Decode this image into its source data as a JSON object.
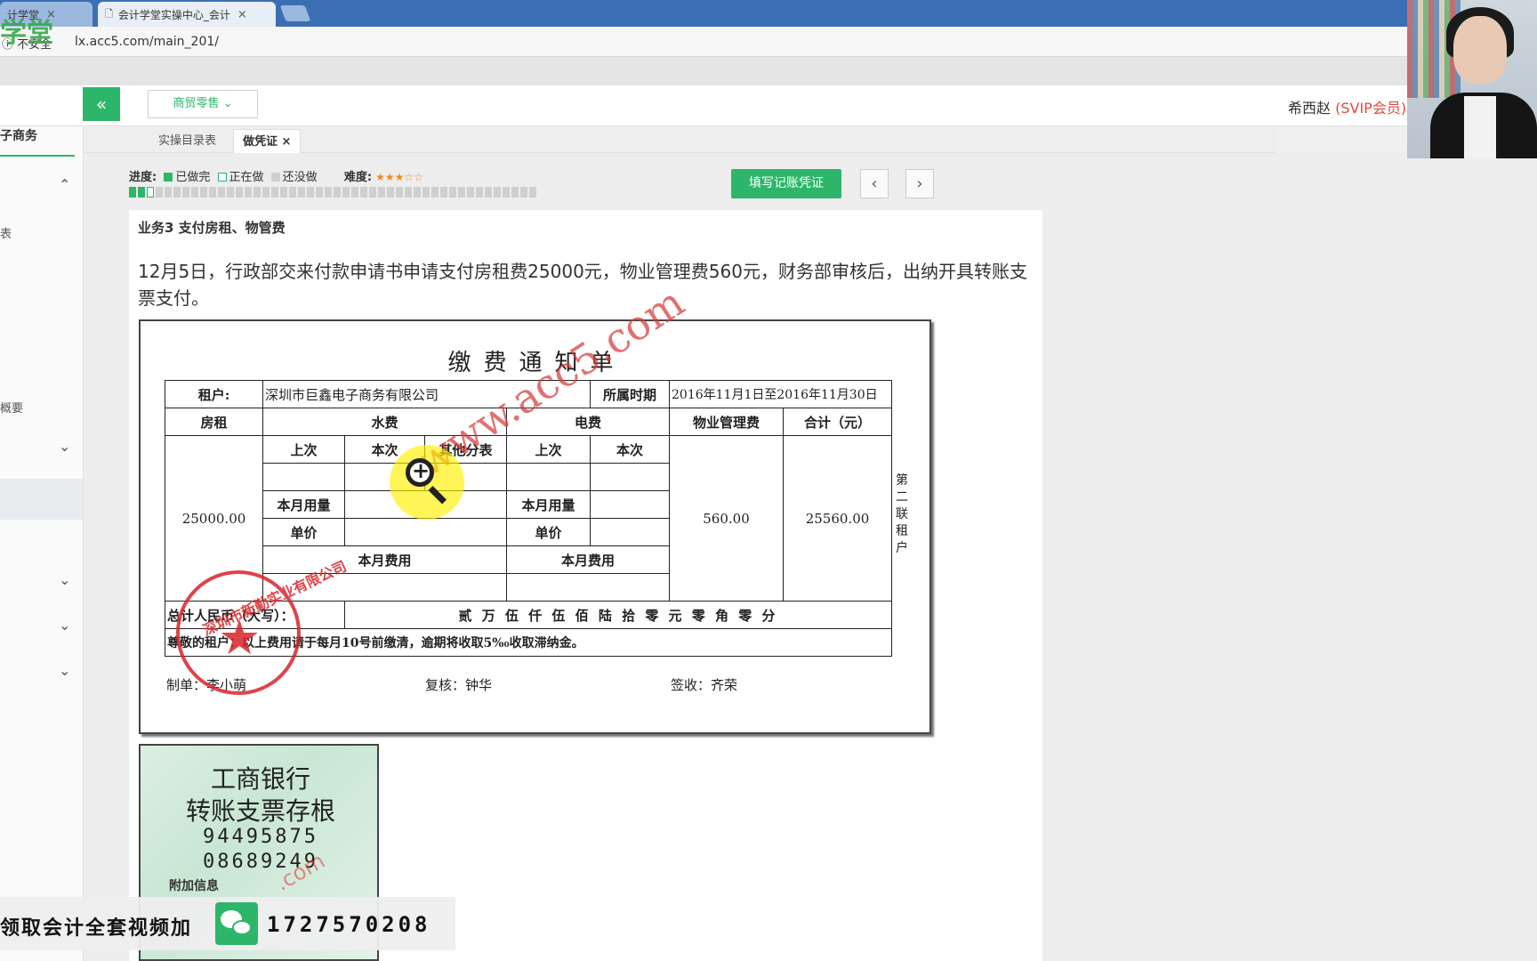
{
  "browser": {
    "tabs": [
      {
        "label": "计学堂"
      },
      {
        "label": "会计学堂实操中心_会计"
      }
    ],
    "security": "不安全",
    "url": "lx.acc5.com/main_201/",
    "logo_ghost": "学堂"
  },
  "header": {
    "dropdown": "商贸零售",
    "user_name": "希西赵",
    "user_level": "(SVIP会员)"
  },
  "sidebar": {
    "title": "子商务",
    "items": [
      {
        "label": "表"
      },
      {
        "label": "概要"
      }
    ]
  },
  "tabs": [
    {
      "label": "实操目录表"
    },
    {
      "label": "做凭证"
    }
  ],
  "progress": {
    "label": "进度:",
    "legend_done": "已做完",
    "legend_doing": "正在做",
    "legend_todo": "还没做",
    "difficulty_label": "难度:",
    "difficulty_stars": "★★★☆☆",
    "done_count": 2,
    "doing_count": 1,
    "total_count": 46,
    "colors": {
      "done": "#2db66a",
      "doing": "#2db66a",
      "todo": "#cfcfcf",
      "accent": "#2db66a"
    }
  },
  "actions": {
    "fill_voucher": "填写记账凭证",
    "prev": "‹",
    "next": "›"
  },
  "business": {
    "title": "业务3 支付房租、物管费",
    "description": "12月5日，行政部交来付款申请书申请支付房租费25000元，物业管理费560元，财务部审核后，出纳开具转账支票支付。"
  },
  "notice": {
    "title": "缴费通知单",
    "tenant_label": "租户:",
    "tenant": "深圳市巨鑫电子商务有限公司",
    "period_label": "所属时期",
    "period": "2016年11月1日至2016年11月30日",
    "rent_label": "房租",
    "water_label": "水费",
    "power_label": "电费",
    "mgmt_label": "物业管理费",
    "total_label": "合计（元）",
    "last": "上次",
    "this": "本次",
    "other_meter": "其他分表",
    "usage": "本月用量",
    "unit_price": "单价",
    "cost": "本月费用",
    "rent": "25000.00",
    "mgmt": "560.00",
    "total": "25560.00",
    "capital_label": "总计人民币（大写）：",
    "capital": "贰 万 伍 仟 伍 佰 陆 拾 零 元 零 角 零 分",
    "notice_text": "尊敬的租户：以上费用请于每月10号前缴清，逾期将收取5%₀收取滞纳金。",
    "maker": "制单：李小萌",
    "checker": "复核：钟华",
    "receiver": "签收：齐荣",
    "copy_mark": "第二联 租户",
    "watermark": "www.acc5.com",
    "stamp_text": "深圳市新勤实业有限公司"
  },
  "stub": {
    "bank": "工商银行",
    "title": "转账支票存根",
    "number1": "94495875",
    "number2": "08689249",
    "extra": "附加信息",
    "watermark": ".com"
  },
  "promo": {
    "text": "领取会计全套视频加",
    "number": "1727570208"
  }
}
